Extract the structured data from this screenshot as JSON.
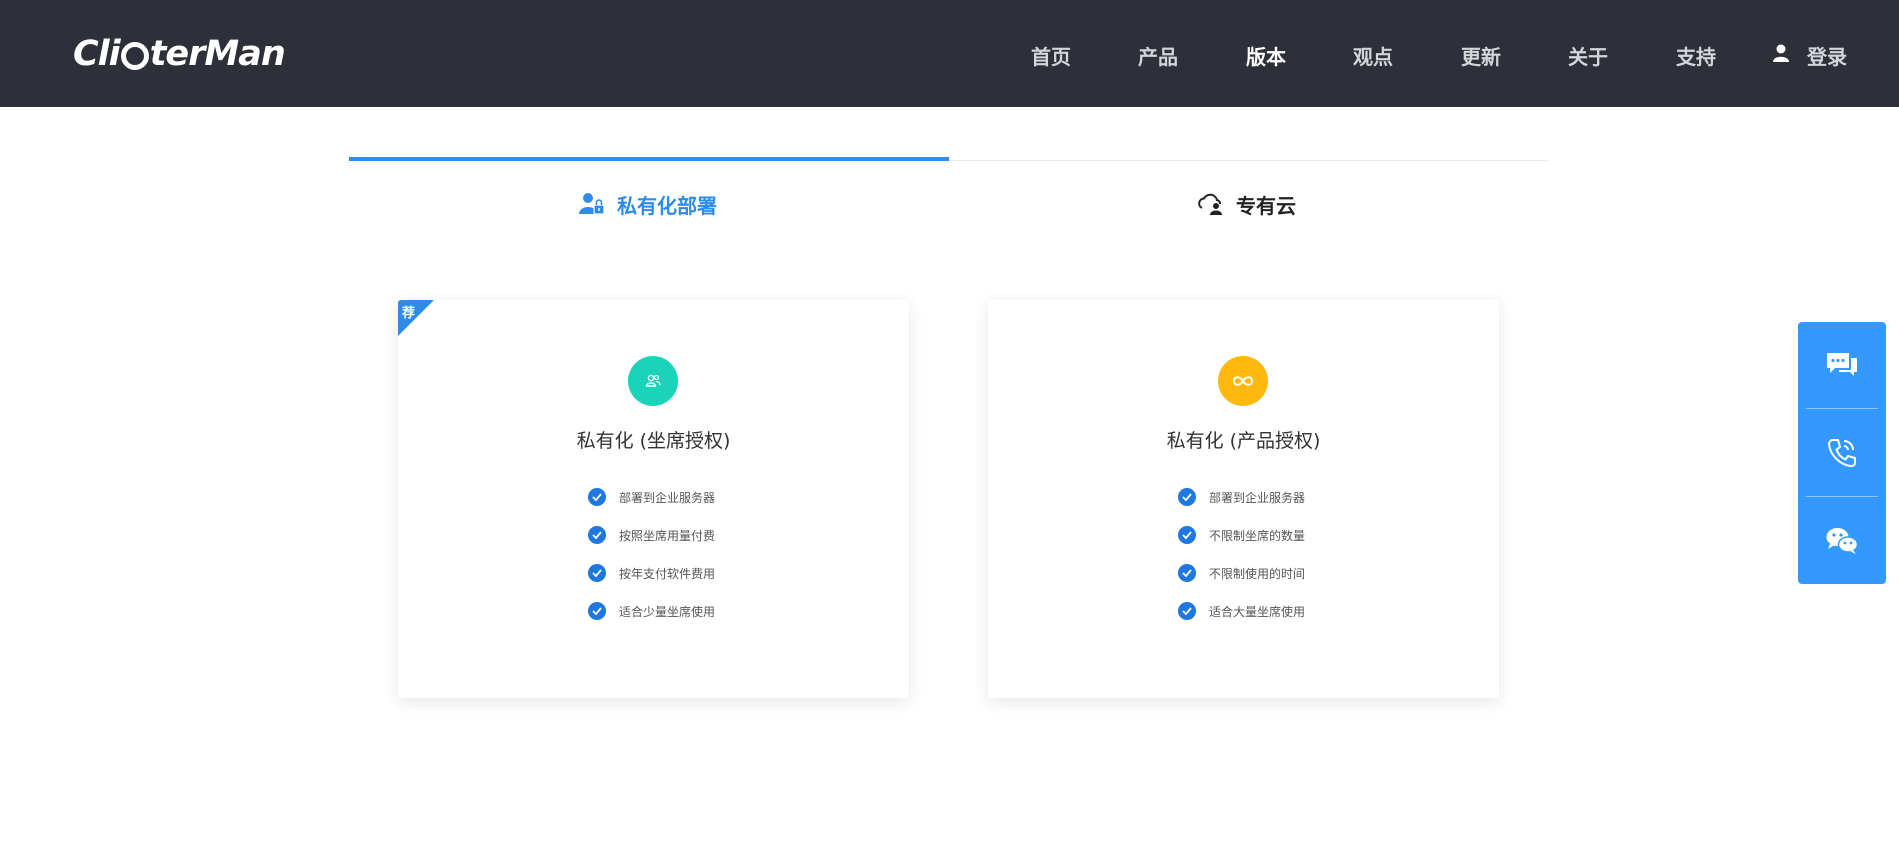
{
  "header": {
    "logo_text_left": "Cli",
    "logo_text_right": "terMan",
    "nav": [
      {
        "label": "首页",
        "active": false
      },
      {
        "label": "产品",
        "active": false
      },
      {
        "label": "版本",
        "active": true
      },
      {
        "label": "观点",
        "active": false
      },
      {
        "label": "更新",
        "active": false
      },
      {
        "label": "关于",
        "active": false
      },
      {
        "label": "支持",
        "active": false
      }
    ],
    "login_label": "登录",
    "user_icon": "user-icon"
  },
  "tabs": [
    {
      "label": "私有化部署",
      "icon": "user-lock-icon",
      "active": true
    },
    {
      "label": "专有云",
      "icon": "cloud-user-icon",
      "active": false
    }
  ],
  "cards": [
    {
      "badge": "荐",
      "icon": "users-icon",
      "icon_color": "#1ad3b8",
      "title": "私有化 (坐席授权)",
      "features": [
        "部署到企业服务器",
        "按照坐席用量付费",
        "按年支付软件费用",
        "适合少量坐席使用"
      ]
    },
    {
      "icon": "infinity-icon",
      "icon_color": "#ffb80d",
      "title": "私有化 (产品授权)",
      "features": [
        "部署到企业服务器",
        "不限制坐席的数量",
        "不限制使用的时间",
        "适合大量坐席使用"
      ]
    }
  ],
  "sidebar": {
    "buttons": [
      "chat-icon",
      "phone-icon",
      "wechat-icon"
    ]
  },
  "colors": {
    "header_bg": "#2d3038",
    "accent": "#2e8be6",
    "check": "#1f78e0",
    "sidebar": "#3399ff"
  }
}
